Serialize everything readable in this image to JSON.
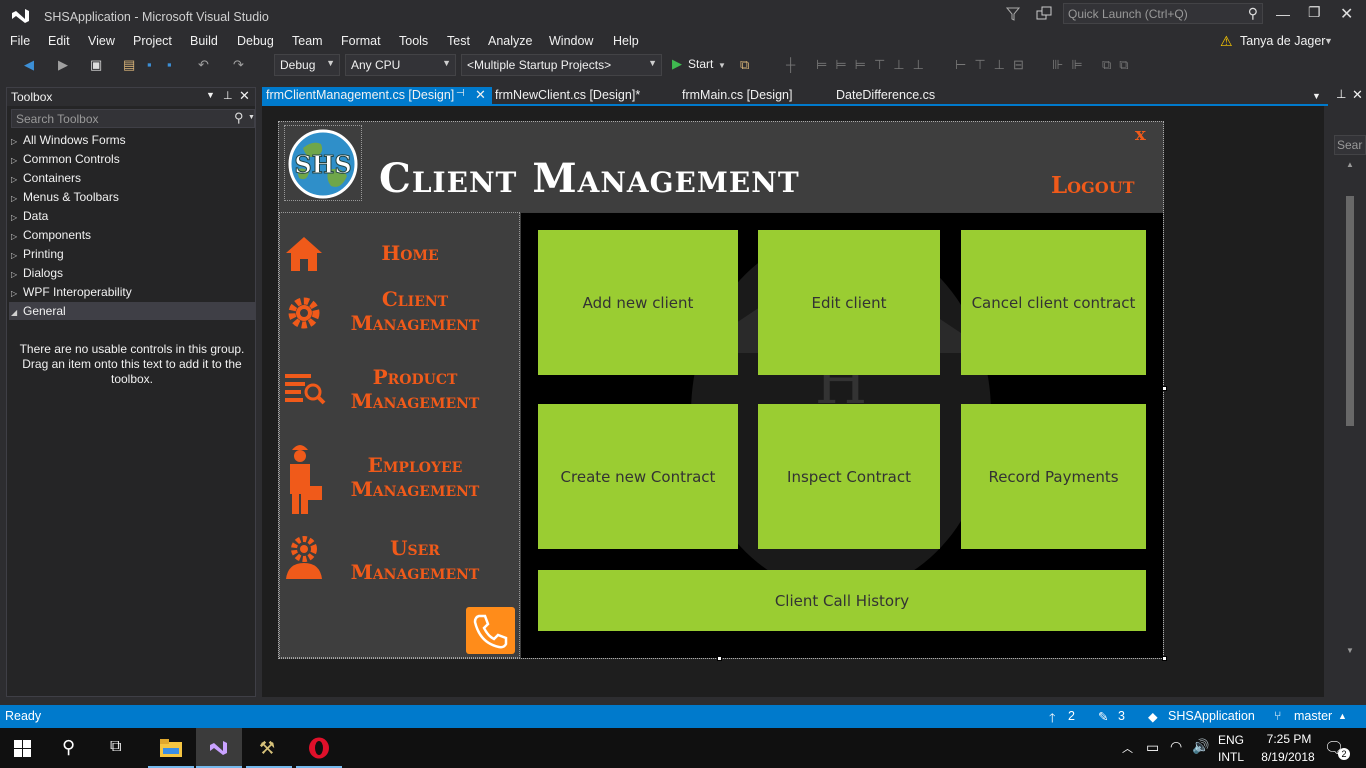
{
  "window": {
    "title": "SHSApplication - Microsoft Visual Studio",
    "quick_launch": "Quick Launch (Ctrl+Q)",
    "user": "Tanya de Jager"
  },
  "menu": [
    "File",
    "Edit",
    "View",
    "Project",
    "Build",
    "Debug",
    "Team",
    "Format",
    "Tools",
    "Test",
    "Analyze",
    "Window",
    "Help"
  ],
  "toolbar": {
    "config": "Debug",
    "platform": "Any CPU",
    "startup": "<Multiple Startup Projects>",
    "start_label": "Start"
  },
  "toolbox": {
    "title": "Toolbox",
    "search_placeholder": "Search Toolbox",
    "groups": [
      "All Windows Forms",
      "Common Controls",
      "Containers",
      "Menus & Toolbars",
      "Data",
      "Components",
      "Printing",
      "Dialogs",
      "WPF Interoperability",
      "General"
    ],
    "empty_message": "There are no usable controls in this group. Drag an item onto this text to add it to the toolbox."
  },
  "tabs": [
    "frmClientManagement.cs [Design]",
    "frmNewClient.cs [Design]*",
    "frmMain.cs [Design]",
    "DateDifference.cs"
  ],
  "right_panel": {
    "search": "Sear"
  },
  "form": {
    "logo_text": "SHS",
    "title": "Client Management",
    "logout": "Logout",
    "close": "x",
    "nav": {
      "home": "Home",
      "client": "Client Management",
      "product": "Product Management",
      "employee": "Employee Management",
      "user": "User Management"
    },
    "tiles": [
      "Add new client",
      "Edit client",
      "Cancel client contract",
      "Create new Contract",
      "Inspect Contract",
      "Record Payments",
      "Client Call History"
    ]
  },
  "status": {
    "text": "Ready",
    "up": "2",
    "edits": "3",
    "project": "SHSApplication",
    "branch": "master"
  },
  "taskbar": {
    "lang1": "ENG",
    "lang2": "INTL",
    "time": "7:25 PM",
    "date": "8/19/2018",
    "notifications": "2"
  },
  "colors": {
    "accent": "#007acc",
    "tile": "#9acd32",
    "orange": "#f05a1a"
  }
}
